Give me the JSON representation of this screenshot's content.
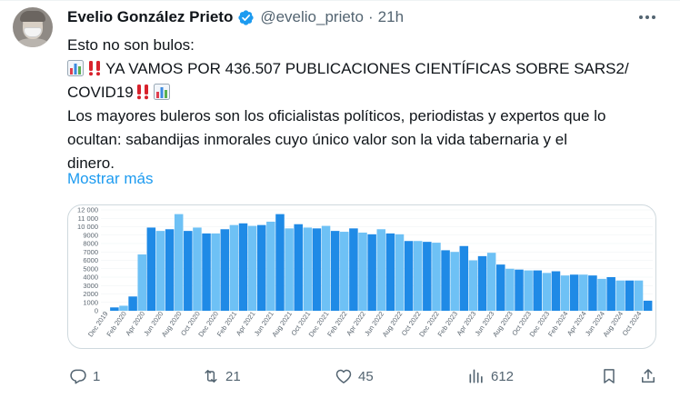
{
  "tweet": {
    "author": {
      "display_name": "Evelio González Prieto",
      "handle": "@evelio_prieto",
      "verified": true,
      "time": "21h",
      "separator": "·"
    },
    "text": {
      "line1": "Esto no son bulos:",
      "line2": "YA VAMOS POR 436.507 PUBLICACIONES CIENTÍFICAS SOBRE SARS2/",
      "line3": "COVID19",
      "line4": "Los mayores buleros son los oficialistas políticos, periodistas y expertos que lo",
      "line5": "ocultan: sabandijas inmorales cuyo único valor son la vida tabernaria y el",
      "line6": "dinero."
    },
    "show_more": "Mostrar más",
    "metrics": {
      "replies": "1",
      "reposts": "21",
      "likes": "45",
      "views": "612"
    },
    "icons": [
      "reply-icon",
      "repost-icon",
      "like-icon",
      "views-icon",
      "bookmark-icon",
      "share-icon",
      "verified-badge-icon",
      "more-options-icon",
      "bar-chart-emoji",
      "double-exclamation-emoji"
    ],
    "colors": {
      "accent": "#1d9bf0",
      "muted": "#536471",
      "bar_light": "#6ec1f5",
      "bar_dark": "#1f8ae6"
    }
  },
  "chart_data": {
    "type": "bar",
    "categories": [
      "Dec 2019",
      "Jan 2020",
      "Feb 2020",
      "Mar 2020",
      "Apr 2020",
      "May 2020",
      "Jun 2020",
      "Jul 2020",
      "Aug 2020",
      "Sep 2020",
      "Oct 2020",
      "Nov 2020",
      "Dec 2020",
      "Jan 2021",
      "Feb 2021",
      "Mar 2021",
      "Apr 2021",
      "May 2021",
      "Jun 2021",
      "Jul 2021",
      "Aug 2021",
      "Sep 2021",
      "Oct 2021",
      "Nov 2021",
      "Dec 2021",
      "Jan 2022",
      "Feb 2022",
      "Mar 2022",
      "Apr 2022",
      "May 2022",
      "Jun 2022",
      "Jul 2022",
      "Aug 2022",
      "Sep 2022",
      "Oct 2022",
      "Nov 2022",
      "Dec 2022",
      "Jan 2023",
      "Feb 2023",
      "Mar 2023",
      "Apr 2023",
      "May 2023",
      "Jun 2023",
      "Jul 2023",
      "Aug 2023",
      "Sep 2023",
      "Oct 2023",
      "Nov 2023",
      "Dec 2023",
      "Jan 2024",
      "Feb 2024",
      "Mar 2024",
      "Apr 2024",
      "May 2024",
      "Jun 2024",
      "Jul 2024",
      "Aug 2024",
      "Sep 2024",
      "Oct 2024",
      "Nov 2024"
    ],
    "tick_labels": [
      "Dec 2019",
      "Feb 2020",
      "Apr 2020",
      "Jun 2020",
      "Aug 2020",
      "Oct 2020",
      "Dec 2020",
      "Feb 2021",
      "Apr 2021",
      "Jun 2021",
      "Aug 2021",
      "Oct 2021",
      "Dec 2021",
      "Feb 2022",
      "Apr 2022",
      "Jun 2022",
      "Aug 2022",
      "Oct 2022",
      "Dec 2022",
      "Feb 2023",
      "Apr 2023",
      "Jun 2023",
      "Aug 2023",
      "Oct 2023",
      "Dec 2023",
      "Feb 2024",
      "Apr 2024",
      "Jun 2024",
      "Aug 2024",
      "Oct 2024"
    ],
    "values": [
      0,
      400,
      600,
      1700,
      6700,
      9900,
      9500,
      9700,
      11500,
      9500,
      9900,
      9200,
      9200,
      9700,
      10200,
      10400,
      10100,
      10200,
      10600,
      11500,
      9800,
      10300,
      9900,
      9800,
      10100,
      9500,
      9400,
      9800,
      9300,
      9100,
      9700,
      9200,
      9100,
      8300,
      8300,
      8200,
      8100,
      7200,
      7000,
      7700,
      6000,
      6500,
      6900,
      5500,
      5000,
      4900,
      4800,
      4800,
      4500,
      4700,
      4200,
      4300,
      4300,
      4200,
      3800,
      4000,
      3600,
      3600,
      3600,
      1200
    ],
    "yticks": [
      "0",
      "1000",
      "2000",
      "3000",
      "4000",
      "5000",
      "6000",
      "7000",
      "8000",
      "9000",
      "10 000",
      "11 000",
      "12 000"
    ],
    "ylim": [
      0,
      12000
    ],
    "grid": true,
    "legend": "none"
  }
}
